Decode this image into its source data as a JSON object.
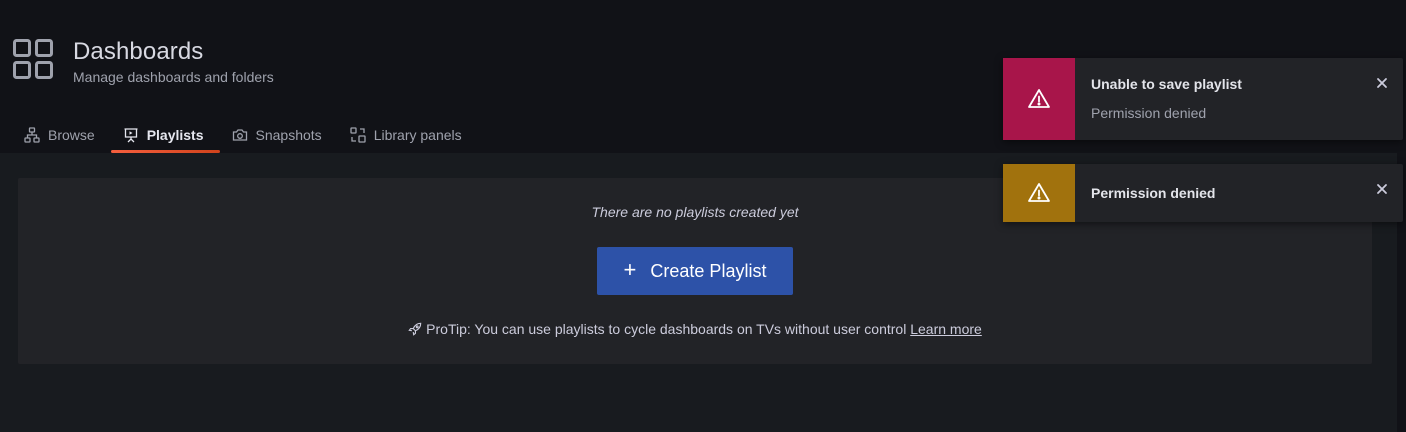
{
  "header": {
    "title": "Dashboards",
    "subtitle": "Manage dashboards and folders",
    "icon": "apps-grid-icon"
  },
  "tabs": [
    {
      "label": "Browse",
      "icon": "sitemap-icon",
      "active": false
    },
    {
      "label": "Playlists",
      "icon": "presentation-play-icon",
      "active": true
    },
    {
      "label": "Snapshots",
      "icon": "camera-icon",
      "active": false
    },
    {
      "label": "Library panels",
      "icon": "library-panel-icon",
      "active": false
    }
  ],
  "empty_state": {
    "title": "There are no playlists created yet",
    "button_plus": "+",
    "button_label": "Create Playlist",
    "protip_text": "ProTip: You can use playlists to cycle dashboards on TVs without user control",
    "protip_link": "Learn more"
  },
  "toasts": [
    {
      "type": "error",
      "title": "Unable to save playlist",
      "text": "Permission denied",
      "color": "#a8154a"
    },
    {
      "type": "warning",
      "title": "Permission denied",
      "color": "#a1720d"
    }
  ],
  "colors": {
    "background": "#111217",
    "panel": "#222327",
    "primary_button": "#2d52a8",
    "active_tab_underline": "#f55f3e"
  }
}
